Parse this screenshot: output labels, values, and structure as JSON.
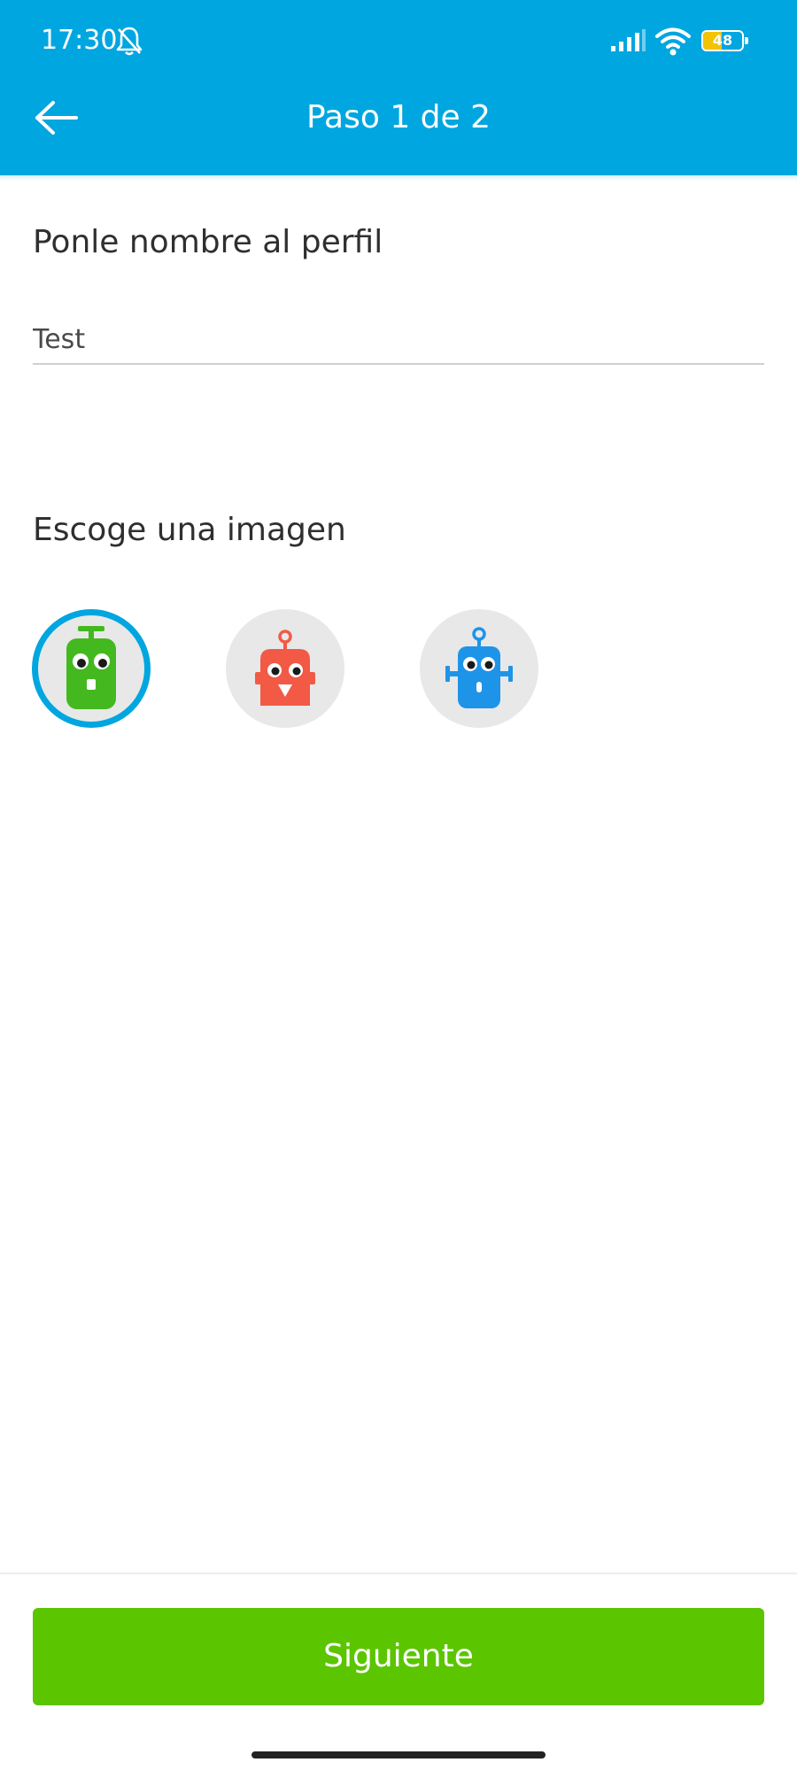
{
  "status_bar": {
    "time": "17:30",
    "battery_level": "48",
    "battery_fraction": 0.48,
    "icons": [
      "bell-off-icon",
      "signal-icon",
      "wifi-icon",
      "battery-icon"
    ]
  },
  "header": {
    "back_icon": "arrow-left-icon",
    "title": "Paso 1 de 2"
  },
  "profile_name": {
    "title": "Ponle nombre al perfil",
    "value": "Test",
    "placeholder": ""
  },
  "image_picker": {
    "title": "Escoge una imagen",
    "selected_index": 0,
    "options": [
      {
        "name": "green-robot-avatar",
        "color": "#44b91f"
      },
      {
        "name": "red-robot-avatar",
        "color": "#f25a45"
      },
      {
        "name": "blue-robot-avatar",
        "color": "#1e94e8"
      }
    ]
  },
  "footer": {
    "next_label": "Siguiente"
  },
  "colors": {
    "accent": "#00a6df",
    "primary_button": "#5bc500"
  }
}
